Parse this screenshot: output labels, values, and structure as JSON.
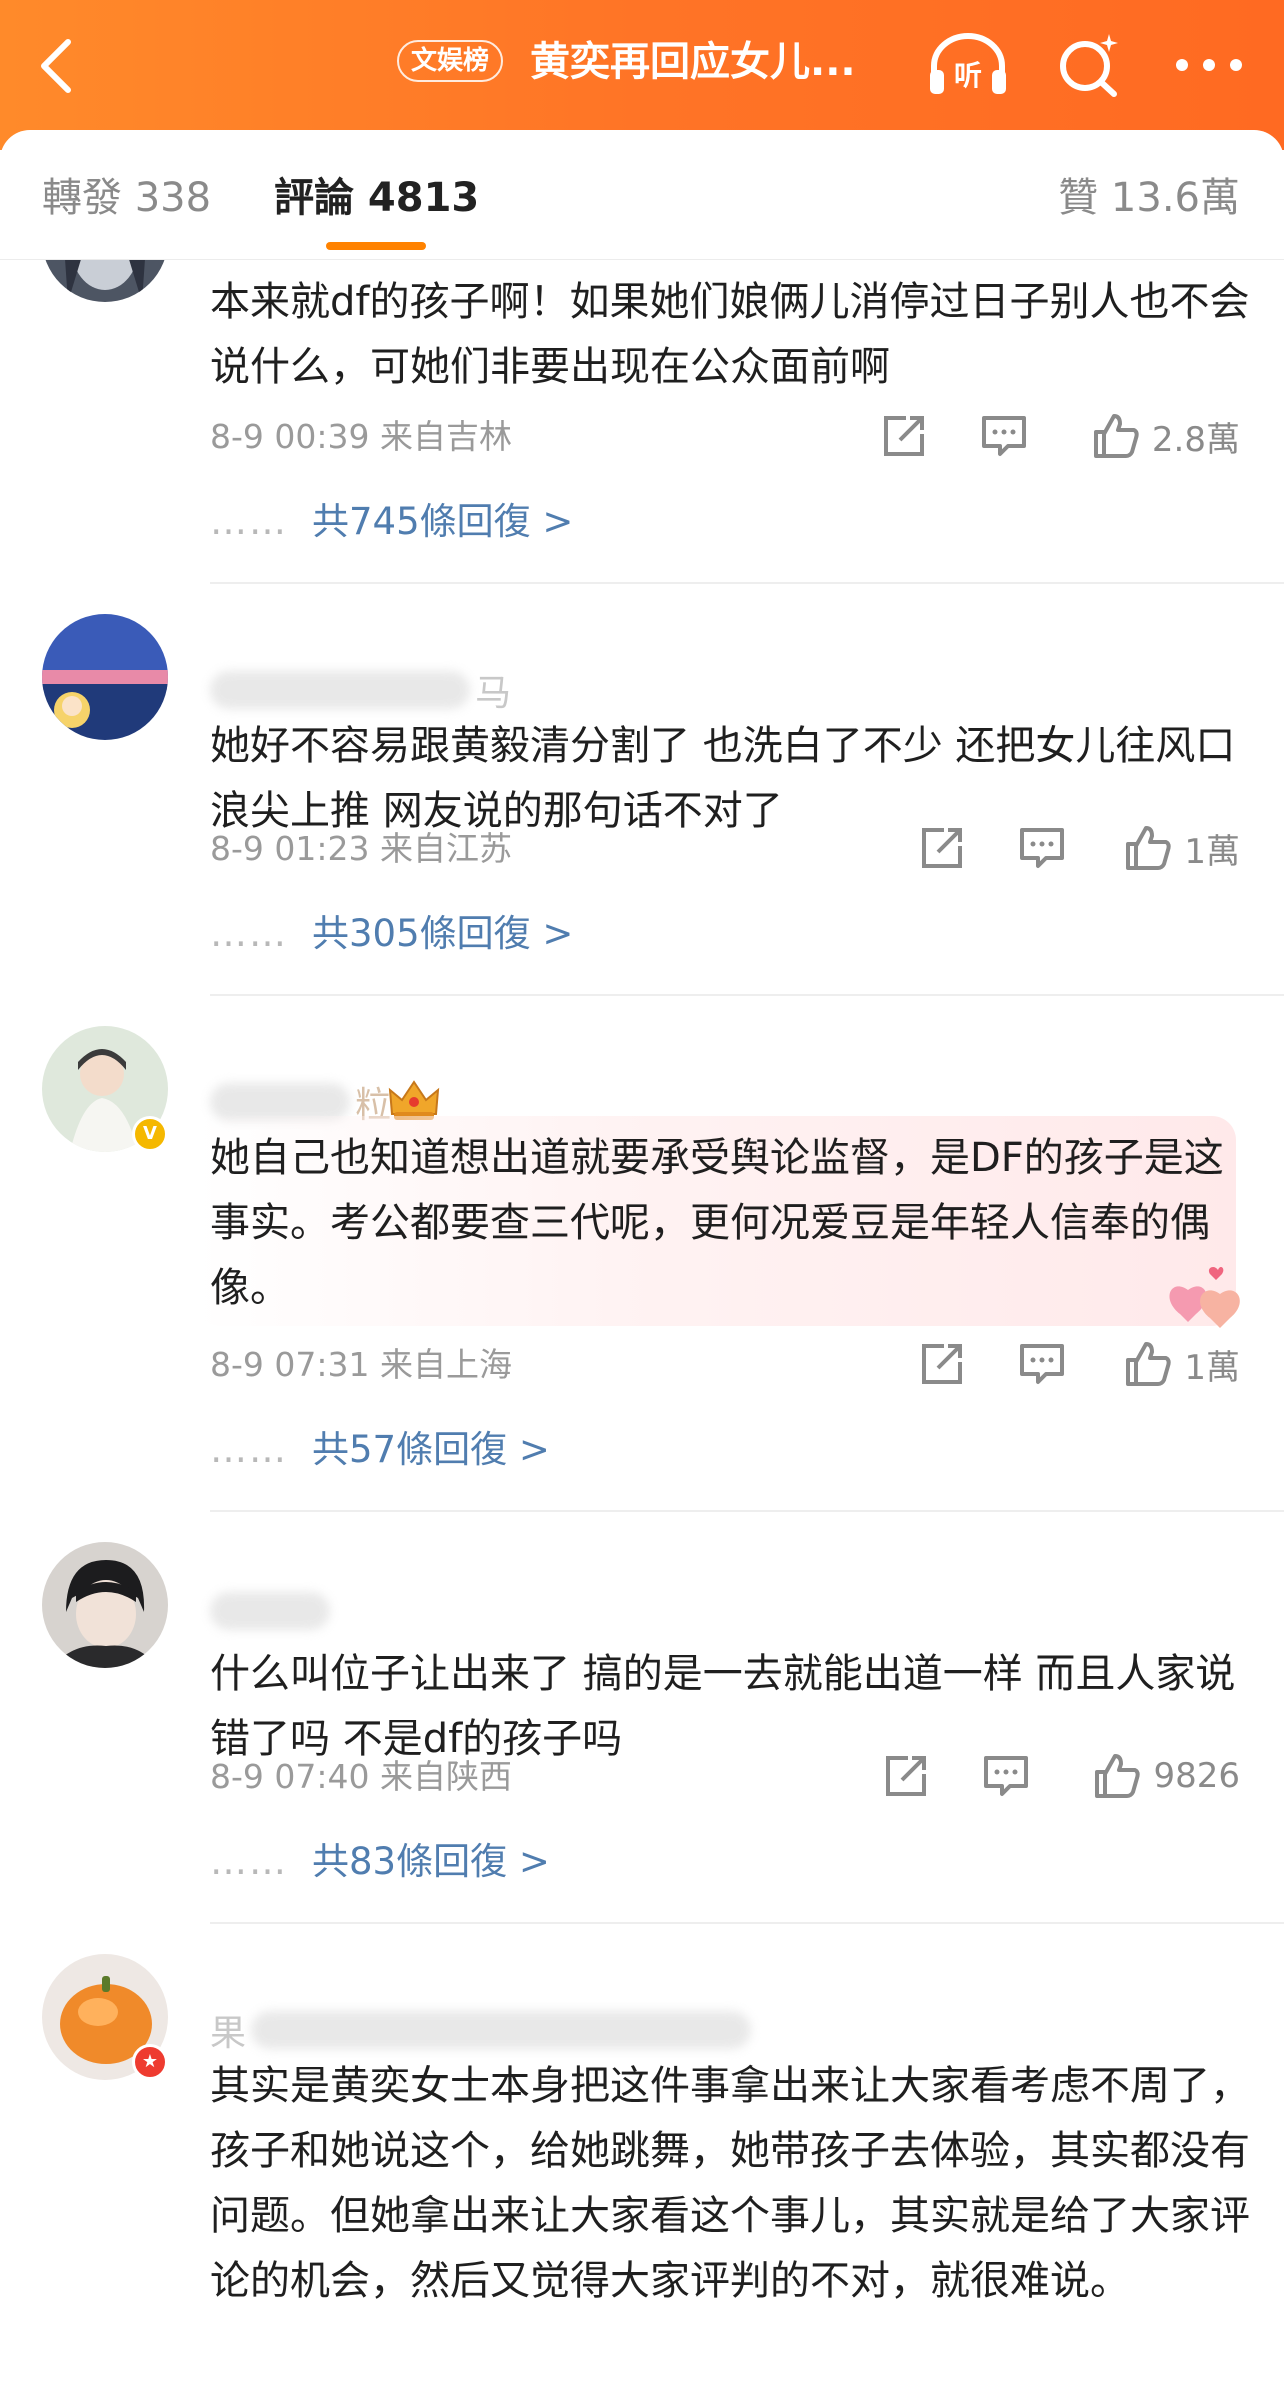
{
  "header": {
    "topic_badge": "文娱榜",
    "title": "黄奕再回应女儿...",
    "icons": [
      "back-icon",
      "listen-icon",
      "search-icon",
      "more-icon"
    ],
    "listen_label": "听",
    "accent_color": "#ff7426"
  },
  "tabs": {
    "repost": "轉發 338",
    "comment": "評論 4813",
    "like": "贊 13.6萬",
    "active_color": "#ff8200"
  },
  "comments": [
    {
      "text": "本来就df的孩子啊！如果她们娘俩儿消停过日子别人也不会说什么，可她们非要出现在公众面前啊",
      "time_location": "8-9 00:39  来自吉林",
      "likes": "2.8萬",
      "replies": "共745條回復 >"
    },
    {
      "username_visible": "马",
      "text": "她好不容易跟黄毅清分割了 也洗白了不少 还把女儿往风口浪尖上推 网友说的那句话不对了",
      "time_location": "8-9 01:23  来自江苏",
      "likes": "1萬",
      "replies": "共305條回復 >"
    },
    {
      "username_visible": "粒",
      "avatar_badge": "V",
      "text": "她自己也知道想出道就要承受舆论监督，是DF的孩子是这事实。考公都要查三代呢，更何况爱豆是年轻人信奉的偶像。",
      "time_location": "8-9 07:31  来自上海",
      "likes": "1萬",
      "replies": "共57條回復 >"
    },
    {
      "text": "什么叫位子让出来了  搞的是一去就能出道一样 而且人家说错了吗 不是df的孩子吗",
      "time_location": "8-9 07:40  来自陕西",
      "likes": "9826",
      "replies": "共83條回復 >"
    },
    {
      "username_visible": "果",
      "avatar_badge": "★",
      "text": "其实是黄奕女士本身把这件事拿出来让大家看考虑不周了，孩子和她说这个，给她跳舞，她带孩子去体验，其实都没有问题。但她拿出来让大家看这个事儿，其实就是给了大家评论的机会，然后又觉得大家评判的不对，就很难说。"
    }
  ],
  "reply_dots": "……"
}
